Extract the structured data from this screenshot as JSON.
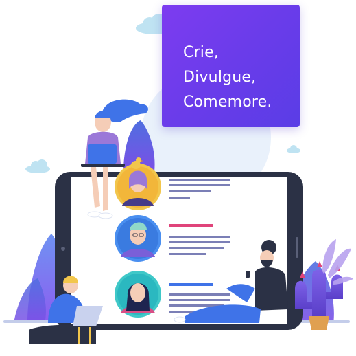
{
  "hero": {
    "lines": [
      "Crie,",
      "Divulgue,",
      "Comemore."
    ]
  },
  "colors": {
    "card_gradient_start": "#7d3cf0",
    "card_gradient_end": "#5a3de6",
    "tablet_frame": "#2b3145",
    "accent_pink": "#e0447a",
    "accent_blue": "#3f73e8",
    "line_gray": "#7b7fb6",
    "bush_blue": "#5b7fe8",
    "cactus_purple": "#6b4fd8"
  },
  "icons": {
    "cloud": "cloud-icon",
    "cactus": "cactus-icon",
    "bird": "bird-icon"
  }
}
